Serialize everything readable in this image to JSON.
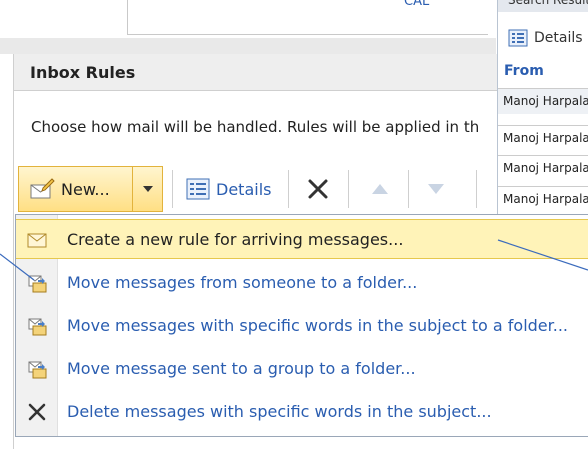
{
  "top_card": {
    "link_text": "CAL"
  },
  "search_panel": {
    "header": "Search Results",
    "details_label": "Details",
    "column_from": "From",
    "rows": [
      "Manoj Harpala",
      "Manoj Harpala",
      "Manoj Harpala",
      "Manoj Harpala"
    ]
  },
  "rules_panel": {
    "title": "Inbox Rules",
    "description": "Choose how mail will be handled. Rules will be applied in th"
  },
  "toolbar": {
    "new_label": "New...",
    "details_label": "Details"
  },
  "menu": {
    "items": [
      {
        "label": "Create a new rule for arriving messages...",
        "icon": "envelope-icon"
      },
      {
        "label": "Move messages from someone to a folder...",
        "icon": "move-folder-icon"
      },
      {
        "label": "Move messages with specific words in the subject to a folder...",
        "icon": "move-folder-icon"
      },
      {
        "label": "Move message sent to a group to a folder...",
        "icon": "move-folder-icon"
      },
      {
        "label": "Delete messages with specific words in the subject...",
        "icon": "delete-x-icon"
      }
    ]
  },
  "colors": {
    "accent": "#2a5db0",
    "highlight": "#fff3b8",
    "button_gradient_top": "#fff5cf",
    "button_gradient_bottom": "#ffdf84"
  }
}
